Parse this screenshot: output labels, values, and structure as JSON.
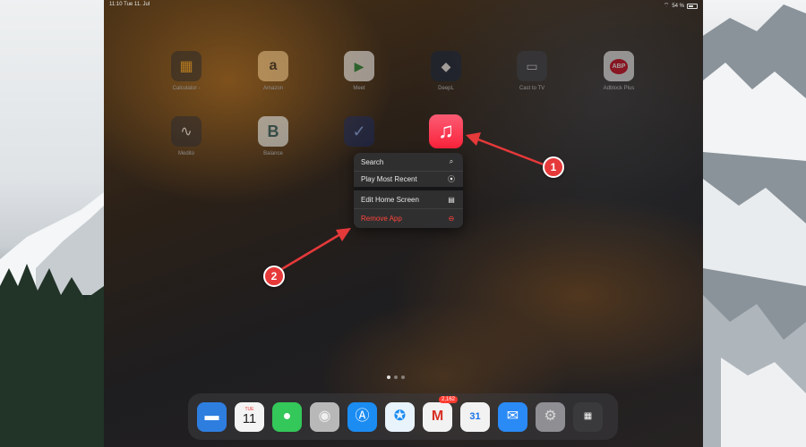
{
  "status_bar": {
    "time": "11:10",
    "date": "Tue 11. Jul",
    "battery": "54 %"
  },
  "home_screen": {
    "apps": [
      {
        "name": "calculator",
        "label": "Calculator -",
        "glyph": "▦"
      },
      {
        "name": "amazon",
        "label": "Amazon",
        "glyph": "a"
      },
      {
        "name": "meet",
        "label": "Meet",
        "glyph": "▶"
      },
      {
        "name": "deepl",
        "label": "DeepL",
        "glyph": "◆"
      },
      {
        "name": "cast",
        "label": "Cast to TV",
        "glyph": "▭"
      },
      {
        "name": "adblock",
        "label": "Adblock Plus",
        "glyph": "ABP"
      },
      {
        "name": "medito",
        "label": "Medito",
        "glyph": "∿"
      },
      {
        "name": "balance",
        "label": "Balance",
        "glyph": "B"
      },
      {
        "name": "todo",
        "label": "",
        "glyph": "✓"
      }
    ],
    "selected_app": {
      "name": "music",
      "glyph": "♫",
      "color": "#fa233b"
    }
  },
  "context_menu": {
    "items": [
      {
        "label": "Search",
        "icon": "search-icon",
        "glyph": "⌕"
      },
      {
        "label": "Play Most Recent",
        "icon": "play-circle-icon",
        "glyph": "⦿"
      },
      {
        "label": "Edit Home Screen",
        "icon": "keyboard-icon",
        "glyph": "▤"
      },
      {
        "label": "Remove App",
        "icon": "minus-circle-icon",
        "glyph": "⊖",
        "destructive": true
      }
    ]
  },
  "annotations": {
    "step1": "1",
    "step2": "2",
    "color": "#e6393a"
  },
  "dock": {
    "calendar_day": "TUE",
    "calendar_date": "11",
    "gmail_badge": "2,162",
    "gcal_date": "31"
  }
}
